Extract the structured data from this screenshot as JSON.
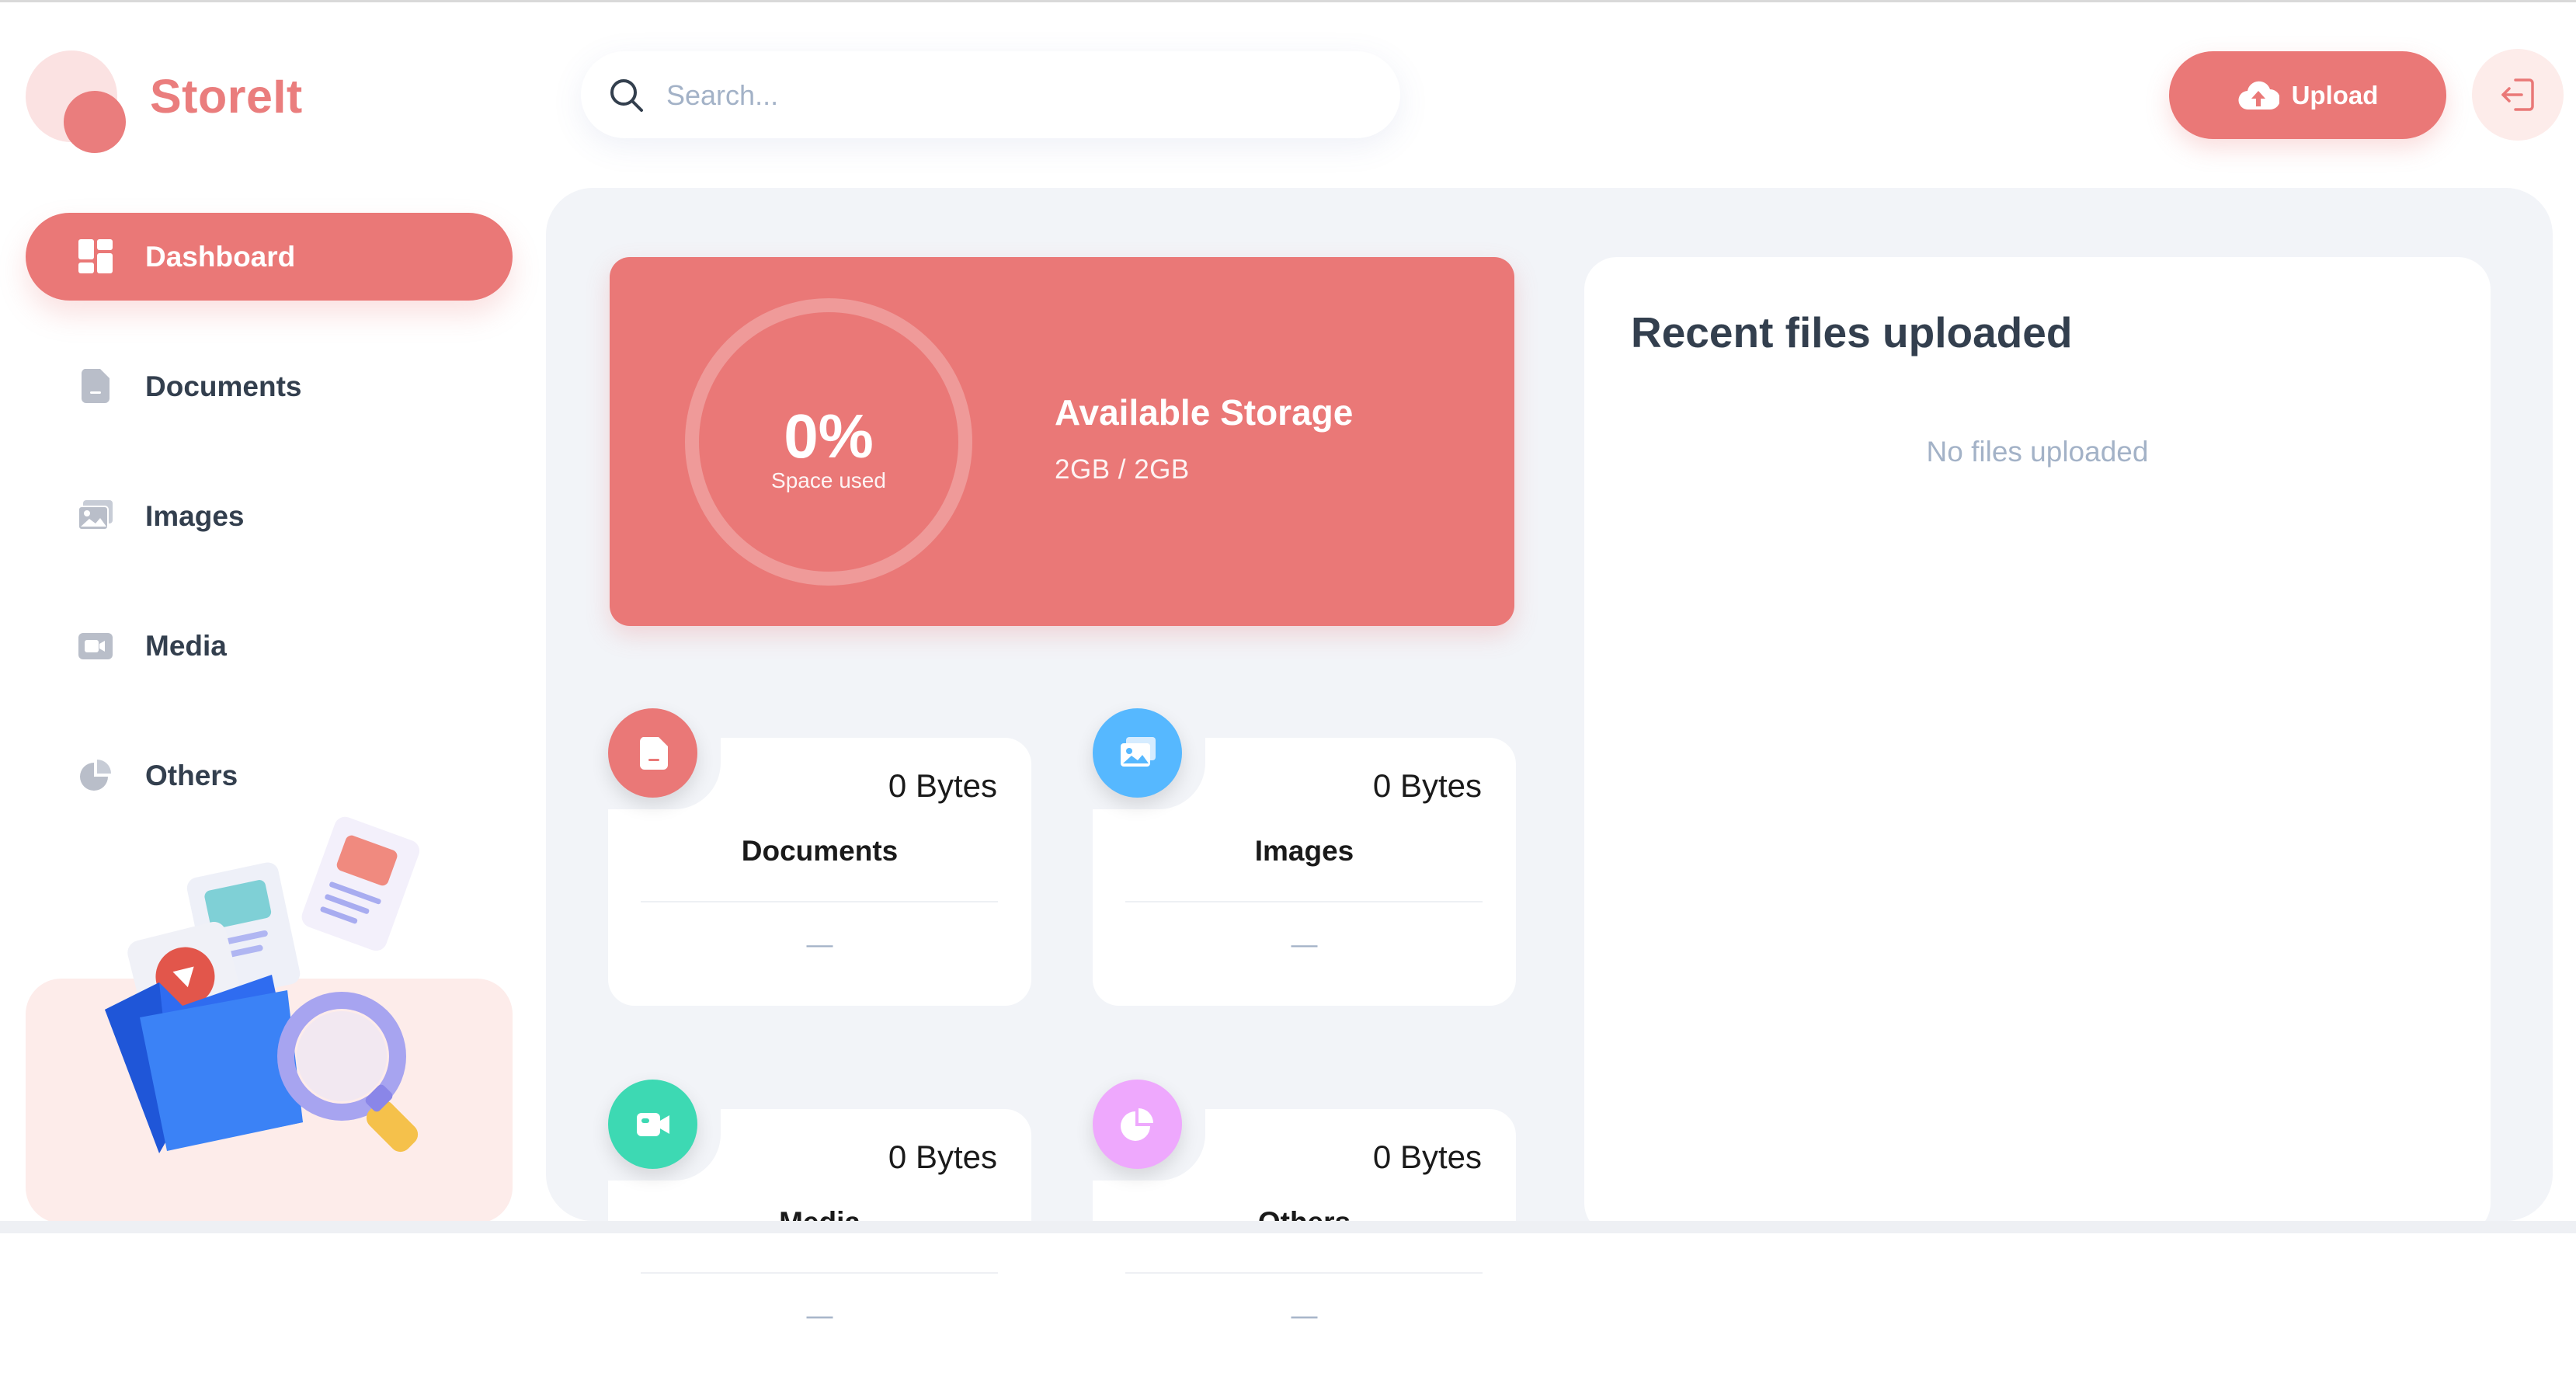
{
  "app": {
    "name": "StoreIt"
  },
  "sidebar": {
    "items": [
      {
        "label": "Dashboard",
        "icon": "dashboard-icon",
        "active": true
      },
      {
        "label": "Documents",
        "icon": "document-icon",
        "active": false
      },
      {
        "label": "Images",
        "icon": "image-icon",
        "active": false
      },
      {
        "label": "Media",
        "icon": "video-icon",
        "active": false
      },
      {
        "label": "Others",
        "icon": "pie-chart-icon",
        "active": false
      }
    ]
  },
  "header": {
    "search": {
      "placeholder": "Search...",
      "value": ""
    },
    "upload_label": "Upload"
  },
  "storage": {
    "percent_used": "0%",
    "percent_value": 0,
    "sub_label": "Space used",
    "title": "Available Storage",
    "value": "2GB / 2GB"
  },
  "categories": [
    {
      "name": "Documents",
      "size": "0 Bytes",
      "last_update": "—",
      "color": "#ea7877",
      "icon": "document-icon"
    },
    {
      "name": "Images",
      "size": "0 Bytes",
      "last_update": "—",
      "color": "#56b8ff",
      "icon": "image-icon"
    },
    {
      "name": "Media",
      "size": "0 Bytes",
      "last_update": "—",
      "color": "#3dd9b3",
      "icon": "video-icon"
    },
    {
      "name": "Others",
      "size": "0 Bytes",
      "last_update": "—",
      "color": "#eea8fd",
      "icon": "pie-chart-icon"
    }
  ],
  "recent": {
    "title": "Recent files uploaded",
    "empty_text": "No files uploaded"
  },
  "colors": {
    "brand": "#ea7877",
    "background": "#f2f4f8",
    "text": "#333f4e",
    "muted": "#a3b2c7"
  }
}
